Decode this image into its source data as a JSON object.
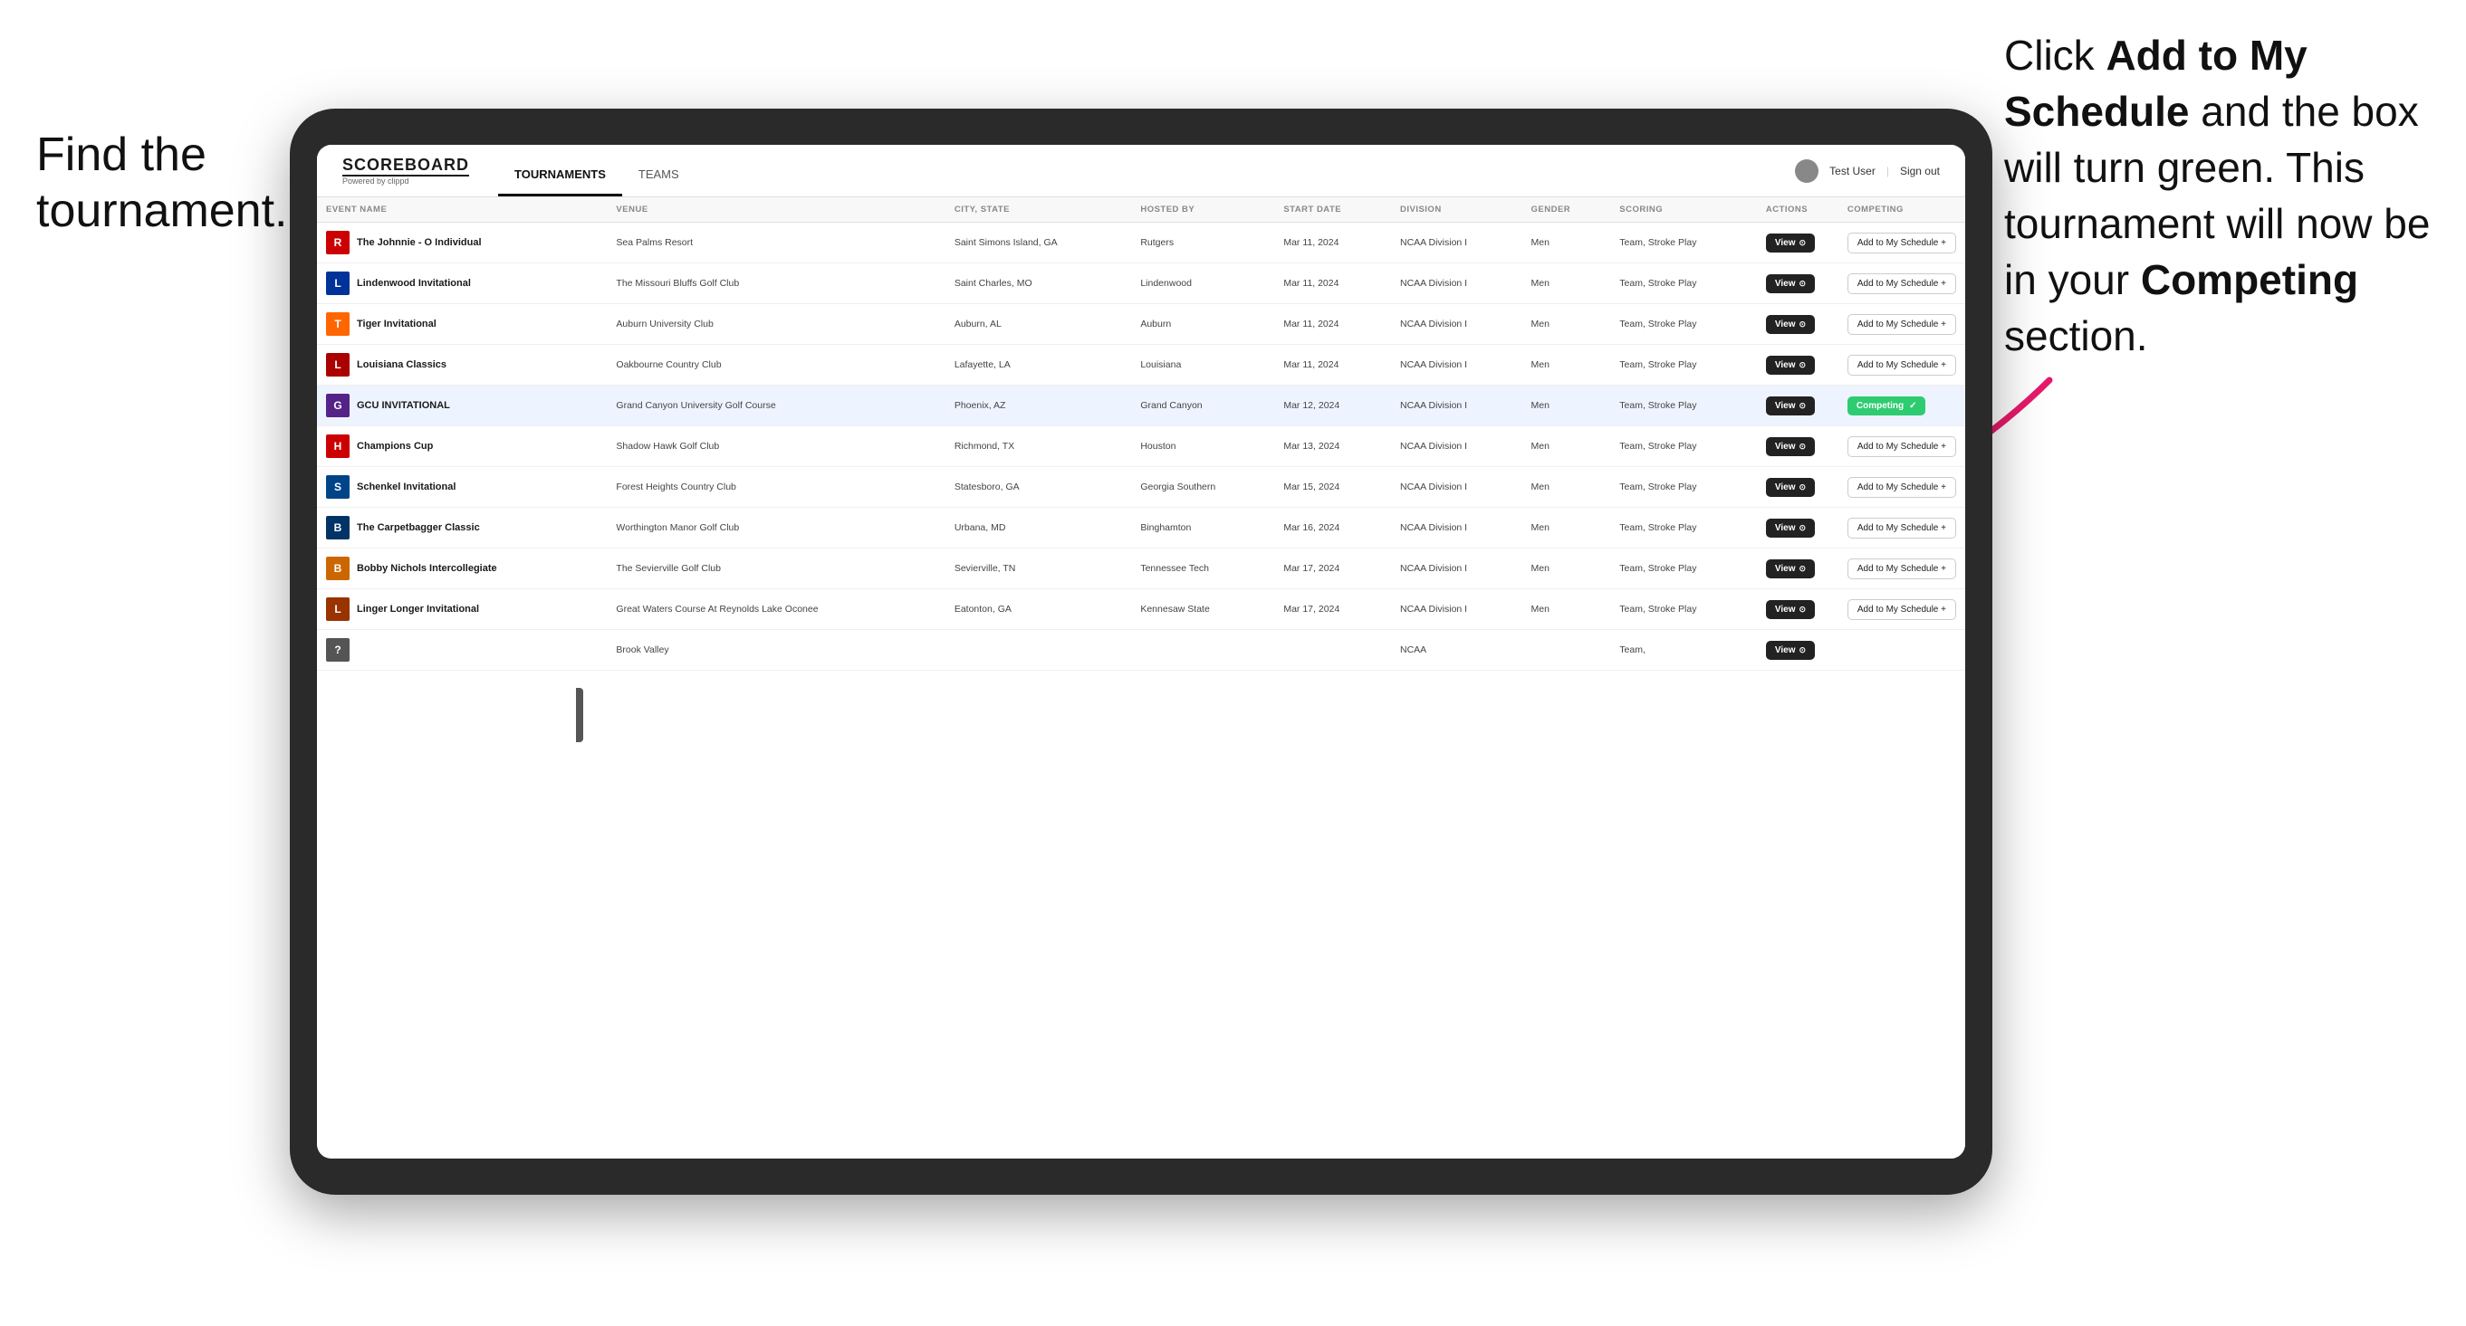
{
  "annotations": {
    "left": "Find the\ntournament.",
    "right_part1": "Click ",
    "right_bold1": "Add to My Schedule",
    "right_part2": " and the box will turn green. This tournament will now be in your ",
    "right_bold2": "Competing",
    "right_part3": " section."
  },
  "header": {
    "logo": "SCOREBOARD",
    "logo_sub": "Powered by clippd",
    "nav": [
      "TOURNAMENTS",
      "TEAMS"
    ],
    "active_nav": "TOURNAMENTS",
    "user": "Test User",
    "signout": "Sign out"
  },
  "table": {
    "columns": [
      "EVENT NAME",
      "VENUE",
      "CITY, STATE",
      "HOSTED BY",
      "START DATE",
      "DIVISION",
      "GENDER",
      "SCORING",
      "ACTIONS",
      "COMPETING"
    ],
    "rows": [
      {
        "logo_color": "#cc0000",
        "logo_letter": "R",
        "logo_shape": "shield",
        "event": "The Johnnie - O Individual",
        "venue": "Sea Palms Resort",
        "city": "Saint Simons Island, GA",
        "hosted": "Rutgers",
        "date": "Mar 11, 2024",
        "division": "NCAA Division I",
        "gender": "Men",
        "scoring": "Team, Stroke Play",
        "action": "View",
        "competing": "Add to My Schedule +",
        "is_competing": false,
        "highlighted": false
      },
      {
        "logo_color": "#003399",
        "logo_letter": "L",
        "logo_shape": "shield",
        "event": "Lindenwood Invitational",
        "venue": "The Missouri Bluffs Golf Club",
        "city": "Saint Charles, MO",
        "hosted": "Lindenwood",
        "date": "Mar 11, 2024",
        "division": "NCAA Division I",
        "gender": "Men",
        "scoring": "Team, Stroke Play",
        "action": "View",
        "competing": "Add to My Schedule +",
        "is_competing": false,
        "highlighted": false
      },
      {
        "logo_color": "#ff6600",
        "logo_letter": "T",
        "logo_shape": "shield",
        "event": "Tiger Invitational",
        "venue": "Auburn University Club",
        "city": "Auburn, AL",
        "hosted": "Auburn",
        "date": "Mar 11, 2024",
        "division": "NCAA Division I",
        "gender": "Men",
        "scoring": "Team, Stroke Play",
        "action": "View",
        "competing": "Add to My Schedule +",
        "is_competing": false,
        "highlighted": false
      },
      {
        "logo_color": "#aa0000",
        "logo_letter": "L",
        "logo_shape": "shield",
        "event": "Louisiana Classics",
        "venue": "Oakbourne Country Club",
        "city": "Lafayette, LA",
        "hosted": "Louisiana",
        "date": "Mar 11, 2024",
        "division": "NCAA Division I",
        "gender": "Men",
        "scoring": "Team, Stroke Play",
        "action": "View",
        "competing": "Add to My Schedule +",
        "is_competing": false,
        "highlighted": false
      },
      {
        "logo_color": "#552288",
        "logo_letter": "G",
        "logo_shape": "shield",
        "event": "GCU INVITATIONAL",
        "venue": "Grand Canyon University Golf Course",
        "city": "Phoenix, AZ",
        "hosted": "Grand Canyon",
        "date": "Mar 12, 2024",
        "division": "NCAA Division I",
        "gender": "Men",
        "scoring": "Team, Stroke Play",
        "action": "View",
        "competing": "Competing",
        "is_competing": true,
        "highlighted": true
      },
      {
        "logo_color": "#cc0000",
        "logo_letter": "H",
        "logo_shape": "shield",
        "event": "Champions Cup",
        "venue": "Shadow Hawk Golf Club",
        "city": "Richmond, TX",
        "hosted": "Houston",
        "date": "Mar 13, 2024",
        "division": "NCAA Division I",
        "gender": "Men",
        "scoring": "Team, Stroke Play",
        "action": "View",
        "competing": "Add to My Schedule +",
        "is_competing": false,
        "highlighted": false
      },
      {
        "logo_color": "#004488",
        "logo_letter": "S",
        "logo_shape": "shield",
        "event": "Schenkel Invitational",
        "venue": "Forest Heights Country Club",
        "city": "Statesboro, GA",
        "hosted": "Georgia Southern",
        "date": "Mar 15, 2024",
        "division": "NCAA Division I",
        "gender": "Men",
        "scoring": "Team, Stroke Play",
        "action": "View",
        "competing": "Add to My Schedule +",
        "is_competing": false,
        "highlighted": false
      },
      {
        "logo_color": "#003366",
        "logo_letter": "B",
        "logo_shape": "shield",
        "event": "The Carpetbagger Classic",
        "venue": "Worthington Manor Golf Club",
        "city": "Urbana, MD",
        "hosted": "Binghamton",
        "date": "Mar 16, 2024",
        "division": "NCAA Division I",
        "gender": "Men",
        "scoring": "Team, Stroke Play",
        "action": "View",
        "competing": "Add to My Schedule +",
        "is_competing": false,
        "highlighted": false
      },
      {
        "logo_color": "#cc6600",
        "logo_letter": "B",
        "logo_shape": "shield",
        "event": "Bobby Nichols Intercollegiate",
        "venue": "The Sevierville Golf Club",
        "city": "Sevierville, TN",
        "hosted": "Tennessee Tech",
        "date": "Mar 17, 2024",
        "division": "NCAA Division I",
        "gender": "Men",
        "scoring": "Team, Stroke Play",
        "action": "View",
        "competing": "Add to My Schedule +",
        "is_competing": false,
        "highlighted": false
      },
      {
        "logo_color": "#993300",
        "logo_letter": "L",
        "logo_shape": "shield",
        "event": "Linger Longer Invitational",
        "venue": "Great Waters Course At Reynolds Lake Oconee",
        "city": "Eatonton, GA",
        "hosted": "Kennesaw State",
        "date": "Mar 17, 2024",
        "division": "NCAA Division I",
        "gender": "Men",
        "scoring": "Team, Stroke Play",
        "action": "View",
        "competing": "Add to My Schedule +",
        "is_competing": false,
        "highlighted": false
      },
      {
        "logo_color": "#555555",
        "logo_letter": "?",
        "logo_shape": "shield",
        "event": "",
        "venue": "Brook Valley",
        "city": "",
        "hosted": "",
        "date": "",
        "division": "NCAA",
        "gender": "",
        "scoring": "Team,",
        "action": "View",
        "competing": "",
        "is_competing": false,
        "highlighted": false
      }
    ]
  },
  "colors": {
    "competing_green": "#2ecc71",
    "view_dark": "#222222",
    "highlight_row": "#eef4ff",
    "arrow_pink": "#e8196a"
  }
}
